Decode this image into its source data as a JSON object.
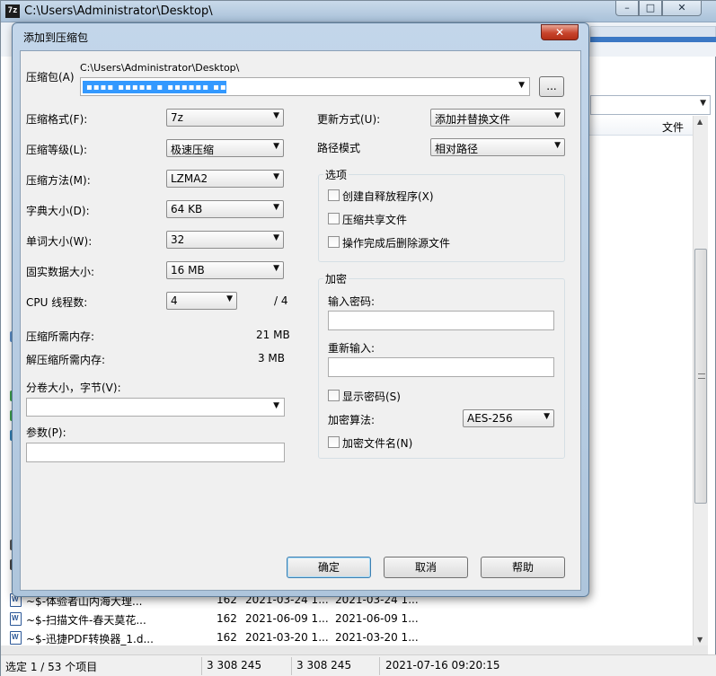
{
  "main_window": {
    "title": "C:\\Users\\Administrator\\Desktop\\",
    "app_icon": "7z",
    "caption_buttons": {
      "minimize": "–",
      "maximize": "□",
      "close": "✕"
    },
    "column_header_file": "文件",
    "files": [
      {
        "name": "~$-体验者山内海大理...",
        "size": "162",
        "modified": "2021-03-24 1...",
        "created": "2021-03-24 1..."
      },
      {
        "name": "~$-扫描文件-春天莫花...",
        "size": "162",
        "modified": "2021-06-09 1...",
        "created": "2021-06-09 1..."
      },
      {
        "name": "~$-迅捷PDF转换器_1.d...",
        "size": "162",
        "modified": "2021-03-20 1...",
        "created": "2021-03-20 1..."
      }
    ],
    "status": {
      "selected": "选定 1 / 53 个项目",
      "size": "3 308 245",
      "packed": "3 308 245",
      "datetime": "2021-07-16 09:20:15"
    }
  },
  "dialog": {
    "title": "添加到压缩包",
    "close_glyph": "✕",
    "archive_label": "压缩包(A)",
    "archive_path": "C:\\Users\\Administrator\\Desktop\\",
    "archive_name_selected": "▪▪▪▪ ▪▪▪▪▪ ▪ ▪▪▪▪▪▪ ▪▪▪",
    "browse_label": "...",
    "format_label": "压缩格式(F):",
    "format_value": "7z",
    "level_label": "压缩等级(L):",
    "level_value": "极速压缩",
    "method_label": "压缩方法(M):",
    "method_value": "LZMA2",
    "dict_label": "字典大小(D):",
    "dict_value": "64 KB",
    "word_label": "单词大小(W):",
    "word_value": "32",
    "solid_label": "固实数据大小:",
    "solid_value": "16 MB",
    "threads_label": "CPU 线程数:",
    "threads_value": "4",
    "threads_total": "/ 4",
    "mem_compress_label": "压缩所需内存:",
    "mem_compress_value": "21 MB",
    "mem_decompress_label": "解压缩所需内存:",
    "mem_decompress_value": "3 MB",
    "volume_label": "分卷大小，字节(V):",
    "volume_value": "",
    "params_label": "参数(P):",
    "params_value": "",
    "update_label": "更新方式(U):",
    "update_value": "添加并替换文件",
    "path_label": "路径模式",
    "path_value": "相对路径",
    "options_title": "选项",
    "opt_sfx": "创建自释放程序(X)",
    "opt_shared": "压缩共享文件",
    "opt_delete": "操作完成后删除源文件",
    "encrypt_title": "加密",
    "pwd_label": "输入密码:",
    "pwd_value": "",
    "repwd_label": "重新输入:",
    "repwd_value": "",
    "show_pwd": "显示密码(S)",
    "enc_method_label": "加密算法:",
    "enc_method_value": "AES-256",
    "enc_names": "加密文件名(N)",
    "ok": "确定",
    "cancel": "取消",
    "help": "帮助",
    "dropdown_arrow": "▼"
  }
}
